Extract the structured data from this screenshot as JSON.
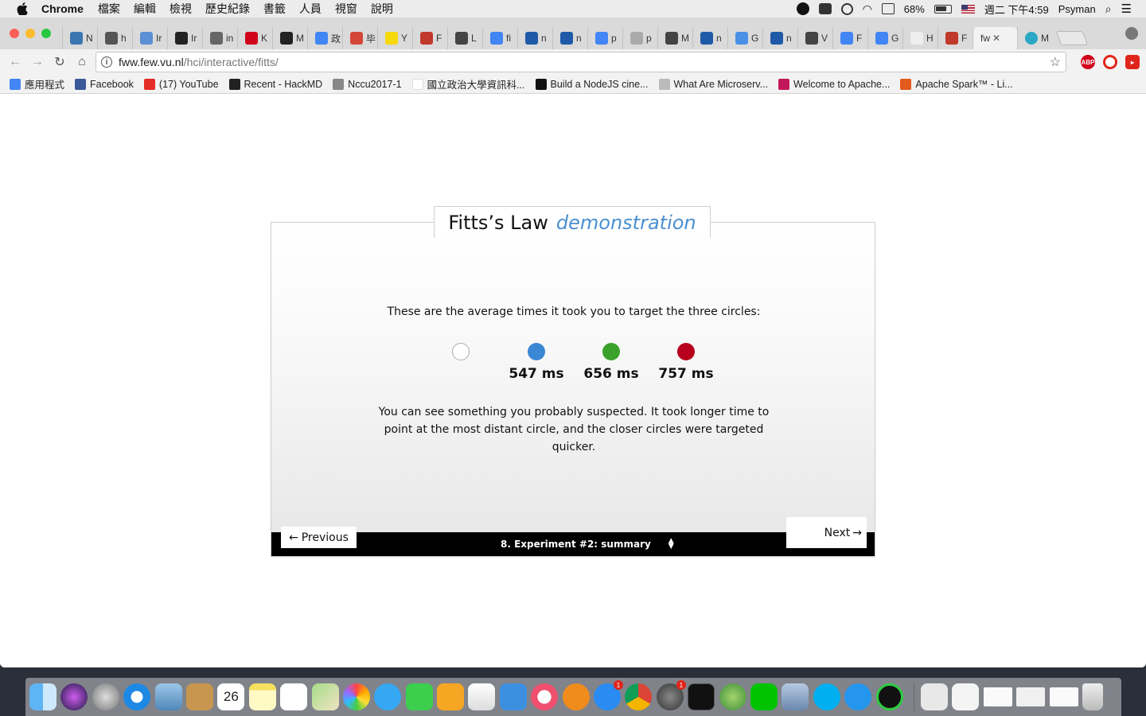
{
  "menubar": {
    "app_name": "Chrome",
    "menus": [
      "檔案",
      "編輯",
      "檢視",
      "歷史紀錄",
      "書籤",
      "人員",
      "視窗",
      "說明"
    ],
    "battery": "68%",
    "clock": "週二 下午4:59",
    "user": "Psyman"
  },
  "tabs": [
    {
      "label": "N",
      "color": "#3b76b0"
    },
    {
      "label": "h",
      "color": "#555555"
    },
    {
      "label": "Ir",
      "color": "#5b8fd6"
    },
    {
      "label": "Ir",
      "color": "#222222"
    },
    {
      "label": "in",
      "color": "#666666"
    },
    {
      "label": "K",
      "color": "#d0021b"
    },
    {
      "label": "M",
      "color": "#222222"
    },
    {
      "label": "政",
      "color": "#4285f4"
    },
    {
      "label": "毕",
      "color": "#d44638"
    },
    {
      "label": "Y",
      "color": "#f5d90a"
    },
    {
      "label": "F",
      "color": "#c0392b"
    },
    {
      "label": "L",
      "color": "#444444"
    },
    {
      "label": "fi",
      "color": "#4285f4"
    },
    {
      "label": "n",
      "color": "#1e5aa8"
    },
    {
      "label": "n",
      "color": "#1e5aa8"
    },
    {
      "label": "p",
      "color": "#4285f4"
    },
    {
      "label": "p",
      "color": "#aaaaaa"
    },
    {
      "label": "M",
      "color": "#444444"
    },
    {
      "label": "n",
      "color": "#1e5aa8"
    },
    {
      "label": "G",
      "color": "#4a8fe7"
    },
    {
      "label": "n",
      "color": "#1e5aa8"
    },
    {
      "label": "V",
      "color": "#444444"
    },
    {
      "label": "F",
      "color": "#4285f4"
    },
    {
      "label": "G",
      "color": "#4285f4"
    },
    {
      "label": "H",
      "color": "#eeeeee"
    },
    {
      "label": "F",
      "color": "#c0392b"
    }
  ],
  "active_tab": {
    "label": "fw",
    "close": "✕"
  },
  "address": {
    "host": "fww.few.vu.nl",
    "path": "/hci/interactive/fitts/"
  },
  "bookmarks": [
    {
      "label": "應用程式",
      "color": "#4285f4"
    },
    {
      "label": "Facebook",
      "color": "#3b5998"
    },
    {
      "label": "(17) YouTube",
      "color": "#e52d27"
    },
    {
      "label": "Recent - HackMD",
      "color": "#222222"
    },
    {
      "label": "Nccu2017-1",
      "color": "#888888"
    },
    {
      "label": "國立政治大學資訊科...",
      "color": "#ffffff"
    },
    {
      "label": "Build a NodeJS cine...",
      "color": "#111111"
    },
    {
      "label": "What Are Microserv...",
      "color": "#bbbbbb"
    },
    {
      "label": "Welcome to Apache...",
      "color": "#c2185b"
    },
    {
      "label": "Apache Spark™ - Li...",
      "color": "#e25a1c"
    }
  ],
  "panel": {
    "title_main": "Fitts’s Law",
    "title_accent": "demonstration",
    "intro": "These are the average times it took you to target the three circles:",
    "results": [
      {
        "color": "#ffffff",
        "time": ""
      },
      {
        "color": "#3a87d4",
        "time": "547 ms"
      },
      {
        "color": "#3aa12a",
        "time": "656 ms"
      },
      {
        "color": "#b8001c",
        "time": "757 ms"
      }
    ],
    "summary": "You can see something you probably suspected. It took longer time to point at the most distant circle, and the closer circles were targeted quicker.",
    "prev_label": "Previous",
    "next_label": "Next",
    "step_label": "8. Experiment #2: summary"
  },
  "dock": {
    "calendar_day": "26",
    "badges": [
      "1",
      "1"
    ]
  }
}
